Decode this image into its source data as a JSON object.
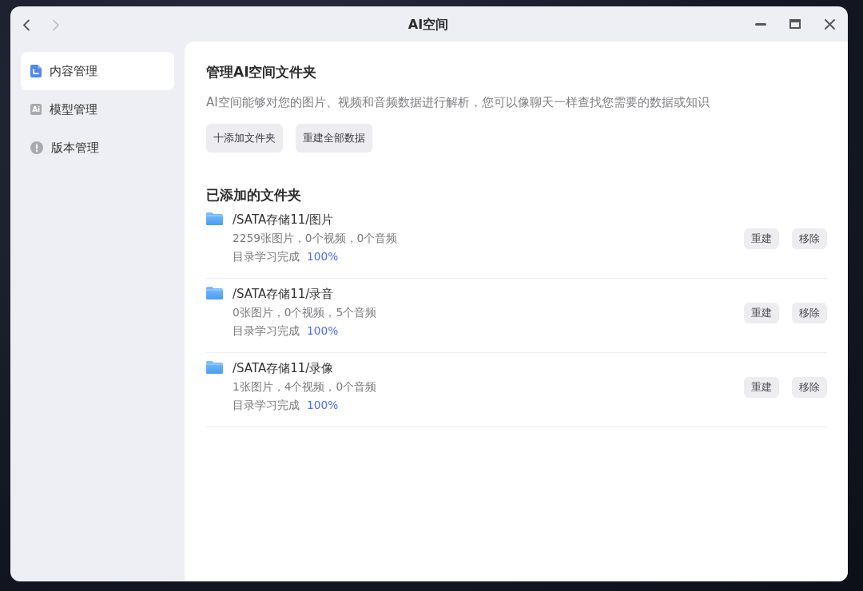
{
  "window": {
    "title": "AI空间",
    "nav": [
      {
        "kind": "back",
        "disabled": false
      },
      {
        "kind": "forward",
        "disabled": true
      }
    ]
  },
  "sidebar": {
    "items": [
      {
        "kind": "content",
        "label": "内容管理",
        "selected": true
      },
      {
        "kind": "model",
        "icon_text": "Ai",
        "label": "模型管理",
        "selected": false
      },
      {
        "kind": "version",
        "label": "版本管理",
        "selected": false
      }
    ]
  },
  "header": {
    "title": "管理AI空间文件夹",
    "description": "AI空间能够对您的图片、视频和音频数据进行解析，您可以像聊天一样查找您需要的数据或知识",
    "buttons": [
      "十添加文件夹",
      "重建全部数据"
    ]
  },
  "folders": {
    "title": "已添加的文件夹",
    "items": [
      {
        "path": "/SATA存储11/图片",
        "stats": "2259张图片，0个视频，0个音频",
        "status": "目录学习完成",
        "progress": "100%",
        "actions": [
          "重建",
          "移除"
        ]
      },
      {
        "path": "/SATA存储11/录音",
        "stats": "0张图片，0个视频，5个音频",
        "status": "目录学习完成",
        "progress": "100%",
        "actions": [
          "重建",
          "移除"
        ]
      },
      {
        "path": "/SATA存储11/录像",
        "stats": "1张图片，4个视频，0个音频",
        "status": "目录学习完成",
        "progress": "100%",
        "actions": [
          "重建",
          "移除"
        ]
      }
    ]
  }
}
